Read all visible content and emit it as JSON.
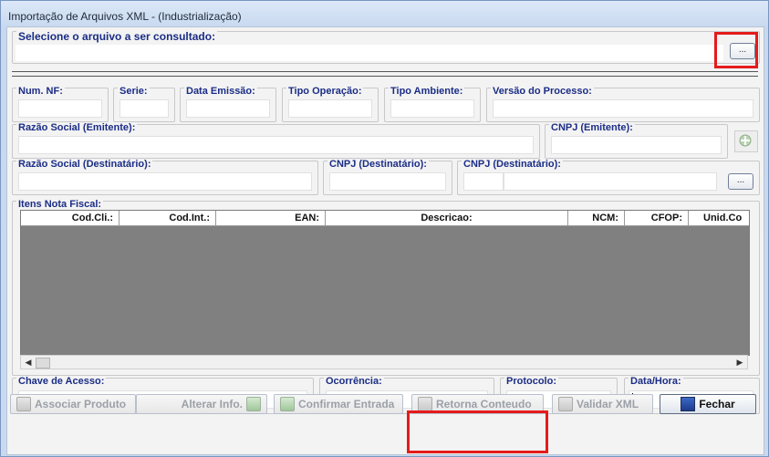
{
  "window": {
    "title": "Importação de Arquivos XML - (Industrialização)"
  },
  "file": {
    "label": "Selecione o arquivo a ser consultado:",
    "browse_label": "..."
  },
  "header": {
    "num_nf": "Num. NF:",
    "serie": "Serie:",
    "data_emissao": "Data Emissão:",
    "tipo_operacao": "Tipo Operação:",
    "tipo_ambiente": "Tipo Ambiente:",
    "versao_processo": "Versão do Processo:",
    "razao_emitente": "Razão Social (Emitente):",
    "cnpj_emitente": "CNPJ (Emitente):",
    "razao_destinatario": "Razão Social (Destinatário):",
    "cnpj_destinatario_1": "CNPJ (Destinatário):",
    "cnpj_destinatario_2": "CNPJ (Destinatário):",
    "dest_browse_label": "..."
  },
  "items": {
    "label": "Itens Nota Fiscal:",
    "columns": [
      "Cod.Cli.:",
      "Cod.Int.:",
      "EAN:",
      "Descricao:",
      "NCM:",
      "CFOP:",
      "Unid.Co"
    ]
  },
  "footer": {
    "chave_acesso": "Chave de Acesso:",
    "ocorrencia": "Ocorrência:",
    "protocolo": "Protocolo:",
    "data_hora": "Data/Hora:"
  },
  "buttons": {
    "associar": "Associar Produto",
    "alterar": "Alterar Info.",
    "confirmar": "Confirmar Entrada",
    "retorna": "Retorna Conteudo",
    "validar": "Validar XML",
    "fechar": "Fechar"
  },
  "icons": [
    "add-icon",
    "edit-icon",
    "check-icon",
    "return-icon",
    "validate-icon",
    "exit-door-icon",
    "scroll-left-icon",
    "scroll-right-icon"
  ],
  "colors": {
    "label_blue": "#1b2d86",
    "highlight_red": "#e41b1b",
    "grid_bg": "#808080"
  }
}
